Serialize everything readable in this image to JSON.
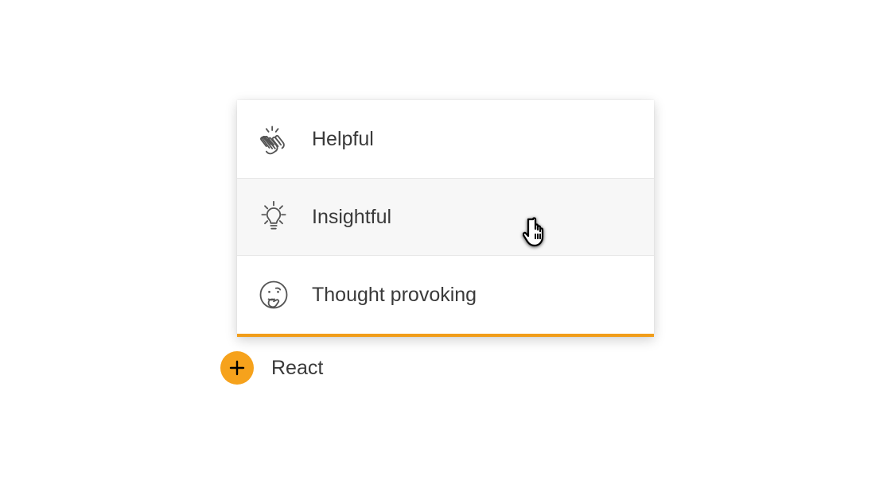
{
  "menu": {
    "items": [
      {
        "label": "Helpful",
        "icon": "clap-icon",
        "hovered": false
      },
      {
        "label": "Insightful",
        "icon": "lightbulb-icon",
        "hovered": true
      },
      {
        "label": "Thought provoking",
        "icon": "thinking-icon",
        "hovered": false
      }
    ]
  },
  "react_button": {
    "label": "React",
    "icon": "plus-icon"
  },
  "colors": {
    "accent": "#f6a21c",
    "text": "#3a3a3a",
    "icon_stroke": "#555555"
  }
}
